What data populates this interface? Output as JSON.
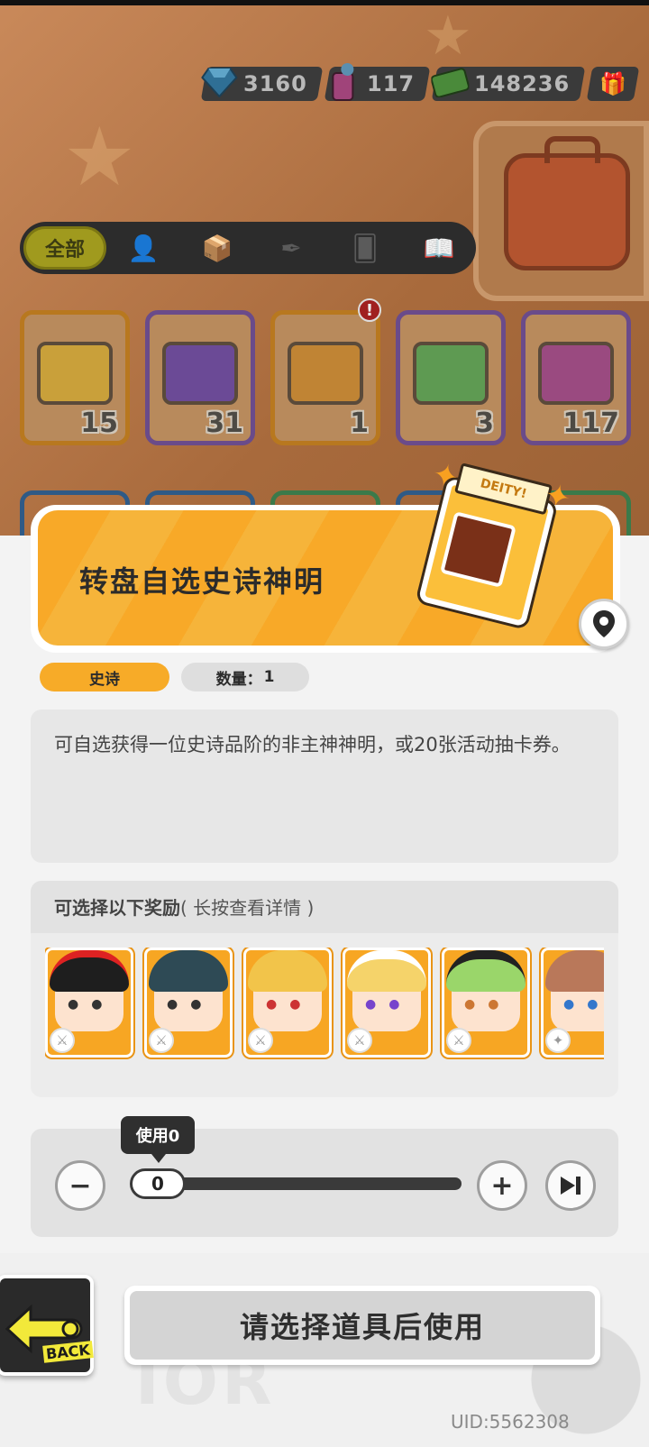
{
  "currencies": [
    {
      "icon": "diamond-icon",
      "value": "3160"
    },
    {
      "icon": "spray-can-icon",
      "value": "117"
    },
    {
      "icon": "cash-icon",
      "value": "148236"
    }
  ],
  "filter_tabs": {
    "all_label": "全部",
    "icons": [
      "person-icon",
      "box-icon",
      "pen-icon",
      "card-icon",
      "book-icon"
    ]
  },
  "inventory": [
    {
      "name": "yellow-ticket",
      "count": "15",
      "color": "#e8c43a"
    },
    {
      "name": "purple-ticket",
      "count": "31",
      "color": "#8a5bc4"
    },
    {
      "name": "deity-box",
      "count": "1",
      "color": "#f2a43a"
    },
    {
      "name": "green-cup",
      "count": "3",
      "color": "#6cc46a"
    },
    {
      "name": "spray-can",
      "count": "117",
      "color": "#d05aa8"
    }
  ],
  "item_detail": {
    "title": "转盘自选史诗神明",
    "box_label": "DEITY!",
    "rarity": "史诗",
    "qty_label": "数量：",
    "qty_value": "1",
    "description": "可自选获得一位史诗品阶的非主神神明，或20张活动抽卡券。"
  },
  "rewards": {
    "header": "可选择以下奖励",
    "header_sub": "( 长按查看详情 )",
    "heroes": [
      {
        "hair": "#1e1e1e",
        "accent": "#d22"
      },
      {
        "hair": "#2e4a55",
        "accent": "#4aa"
      },
      {
        "hair": "#f2c44a",
        "accent": "#e66"
      },
      {
        "hair": "#f5d36a",
        "accent": "#fff"
      },
      {
        "hair": "#9ad66a",
        "accent": "#222"
      },
      {
        "hair": "#b9785a",
        "accent": "#6ad"
      }
    ]
  },
  "usage": {
    "tooltip": "使用0",
    "value": "0",
    "minus": "−",
    "plus": "+"
  },
  "back_label": "BACK",
  "use_button": "请选择道具后使用",
  "uid": "UID:5562308"
}
